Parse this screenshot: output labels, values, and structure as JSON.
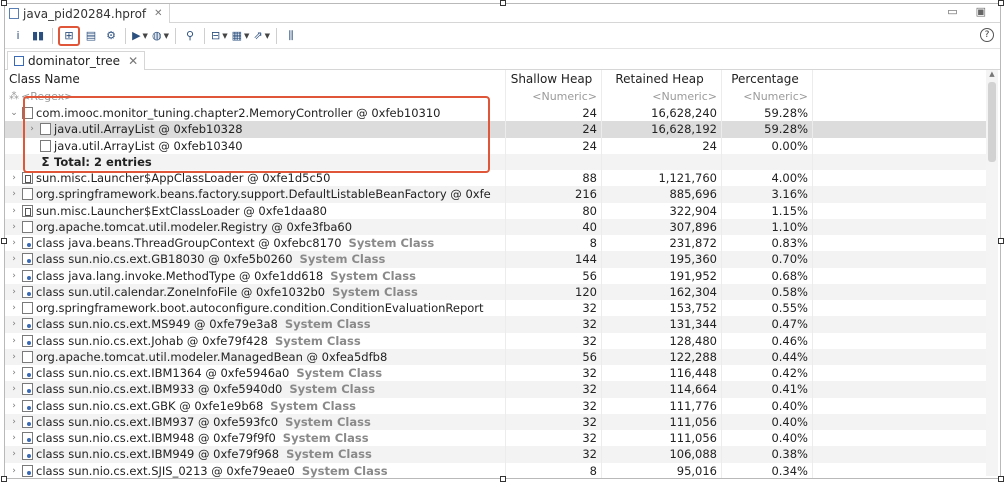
{
  "editor_tab": {
    "title": "java_pid20284.hprof"
  },
  "view_tab": {
    "title": "dominator_tree"
  },
  "toolbar": {
    "items": [
      {
        "name": "info-icon",
        "glyph": "i"
      },
      {
        "name": "histogram-icon",
        "glyph": "▮▮"
      },
      {
        "name": "dominator-tree-icon",
        "glyph": "⊞",
        "selected": true
      },
      {
        "name": "oql-icon",
        "glyph": "▤"
      },
      {
        "name": "thread-overview-icon",
        "glyph": "⚙"
      },
      {
        "name": "run-report-icon",
        "glyph": "▶",
        "dropdown": true
      },
      {
        "name": "query-browser-icon",
        "glyph": "◍",
        "dropdown": true
      },
      {
        "name": "search-icon",
        "glyph": "⚲"
      },
      {
        "name": "group-by-icon",
        "glyph": "⊟",
        "dropdown": true
      },
      {
        "name": "columns-icon",
        "glyph": "▦",
        "dropdown": true
      },
      {
        "name": "export-icon",
        "glyph": "⇗",
        "dropdown": true
      },
      {
        "name": "calculate-retained-icon",
        "glyph": "⫼"
      }
    ]
  },
  "columns": {
    "name": "Class Name",
    "shallow": "Shallow Heap",
    "retained": "Retained Heap",
    "percentage": "Percentage"
  },
  "filters": {
    "name": "<Regex>",
    "shallow": "<Numeric>",
    "retained": "<Numeric>",
    "percentage": "<Numeric>"
  },
  "rows": [
    {
      "indent": 0,
      "expander": "⌄",
      "icon": "obj",
      "name": "com.imooc.monitor_tuning.chapter2.MemoryController @ 0xfeb10310",
      "shallow": "24",
      "retained": "16,628,240",
      "percentage": "59.28%"
    },
    {
      "indent": 1,
      "expander": "›",
      "icon": "obj",
      "name": "java.util.ArrayList @ 0xfeb10328",
      "shallow": "24",
      "retained": "16,628,192",
      "percentage": "59.28%",
      "highlight": true
    },
    {
      "indent": 1,
      "expander": "",
      "icon": "obj",
      "name": "java.util.ArrayList @ 0xfeb10340",
      "shallow": "24",
      "retained": "24",
      "percentage": "0.00%"
    },
    {
      "indent": 1,
      "expander": "",
      "icon": "sigma",
      "name": "Total: 2 entries",
      "shallow": "",
      "retained": "",
      "percentage": "",
      "total": true
    },
    {
      "indent": 0,
      "expander": "›",
      "icon": "ldr",
      "name": "sun.misc.Launcher$AppClassLoader @ 0xfe1d5c50",
      "shallow": "88",
      "retained": "1,121,760",
      "percentage": "4.00%"
    },
    {
      "indent": 0,
      "expander": "›",
      "icon": "obj",
      "name": "org.springframework.beans.factory.support.DefaultListableBeanFactory @ 0xfe",
      "shallow": "216",
      "retained": "885,696",
      "percentage": "3.16%"
    },
    {
      "indent": 0,
      "expander": "›",
      "icon": "ldr",
      "name": "sun.misc.Launcher$ExtClassLoader @ 0xfe1daa80",
      "shallow": "80",
      "retained": "322,904",
      "percentage": "1.15%"
    },
    {
      "indent": 0,
      "expander": "›",
      "icon": "obj",
      "name": "org.apache.tomcat.util.modeler.Registry @ 0xfe3fba60",
      "shallow": "40",
      "retained": "307,896",
      "percentage": "1.10%"
    },
    {
      "indent": 0,
      "expander": "›",
      "icon": "cls",
      "name": "class java.beans.ThreadGroupContext @ 0xfebc8170",
      "sys": "System Class",
      "shallow": "8",
      "retained": "231,872",
      "percentage": "0.83%"
    },
    {
      "indent": 0,
      "expander": "›",
      "icon": "cls",
      "name": "class sun.nio.cs.ext.GB18030 @ 0xfe5b0260",
      "sys": "System Class",
      "shallow": "144",
      "retained": "195,360",
      "percentage": "0.70%"
    },
    {
      "indent": 0,
      "expander": "›",
      "icon": "cls",
      "name": "class java.lang.invoke.MethodType @ 0xfe1dd618",
      "sys": "System Class",
      "shallow": "56",
      "retained": "191,952",
      "percentage": "0.68%"
    },
    {
      "indent": 0,
      "expander": "›",
      "icon": "cls",
      "name": "class sun.util.calendar.ZoneInfoFile @ 0xfe1032b0",
      "sys": "System Class",
      "shallow": "120",
      "retained": "162,304",
      "percentage": "0.58%"
    },
    {
      "indent": 0,
      "expander": "›",
      "icon": "obj",
      "name": "org.springframework.boot.autoconfigure.condition.ConditionEvaluationReport",
      "shallow": "32",
      "retained": "153,752",
      "percentage": "0.55%"
    },
    {
      "indent": 0,
      "expander": "›",
      "icon": "cls",
      "name": "class sun.nio.cs.ext.MS949 @ 0xfe79e3a8",
      "sys": "System Class",
      "shallow": "32",
      "retained": "131,344",
      "percentage": "0.47%"
    },
    {
      "indent": 0,
      "expander": "›",
      "icon": "cls",
      "name": "class sun.nio.cs.ext.Johab @ 0xfe79f428",
      "sys": "System Class",
      "shallow": "32",
      "retained": "128,480",
      "percentage": "0.46%"
    },
    {
      "indent": 0,
      "expander": "›",
      "icon": "obj",
      "name": "org.apache.tomcat.util.modeler.ManagedBean @ 0xfea5dfb8",
      "shallow": "56",
      "retained": "122,288",
      "percentage": "0.44%"
    },
    {
      "indent": 0,
      "expander": "›",
      "icon": "cls",
      "name": "class sun.nio.cs.ext.IBM1364 @ 0xfe5946a0",
      "sys": "System Class",
      "shallow": "32",
      "retained": "116,448",
      "percentage": "0.42%"
    },
    {
      "indent": 0,
      "expander": "›",
      "icon": "cls",
      "name": "class sun.nio.cs.ext.IBM933 @ 0xfe5940d0",
      "sys": "System Class",
      "shallow": "32",
      "retained": "114,664",
      "percentage": "0.41%"
    },
    {
      "indent": 0,
      "expander": "›",
      "icon": "cls",
      "name": "class sun.nio.cs.ext.GBK @ 0xfe1e9b68",
      "sys": "System Class",
      "shallow": "32",
      "retained": "111,776",
      "percentage": "0.40%"
    },
    {
      "indent": 0,
      "expander": "›",
      "icon": "cls",
      "name": "class sun.nio.cs.ext.IBM937 @ 0xfe593fc0",
      "sys": "System Class",
      "shallow": "32",
      "retained": "111,056",
      "percentage": "0.40%"
    },
    {
      "indent": 0,
      "expander": "›",
      "icon": "cls",
      "name": "class sun.nio.cs.ext.IBM948 @ 0xfe79f9f0",
      "sys": "System Class",
      "shallow": "32",
      "retained": "111,056",
      "percentage": "0.40%"
    },
    {
      "indent": 0,
      "expander": "›",
      "icon": "cls",
      "name": "class sun.nio.cs.ext.IBM949 @ 0xfe79f968",
      "sys": "System Class",
      "shallow": "32",
      "retained": "106,088",
      "percentage": "0.38%"
    },
    {
      "indent": 0,
      "expander": "›",
      "icon": "cls",
      "name": "class sun.nio.cs.ext.SJIS_0213 @ 0xfe79eae0",
      "sys": "System Class",
      "shallow": "8",
      "retained": "95,016",
      "percentage": "0.34%"
    }
  ],
  "colors": {
    "annotation_red": "#e05638",
    "highlight_row": "#dcdcdc"
  }
}
